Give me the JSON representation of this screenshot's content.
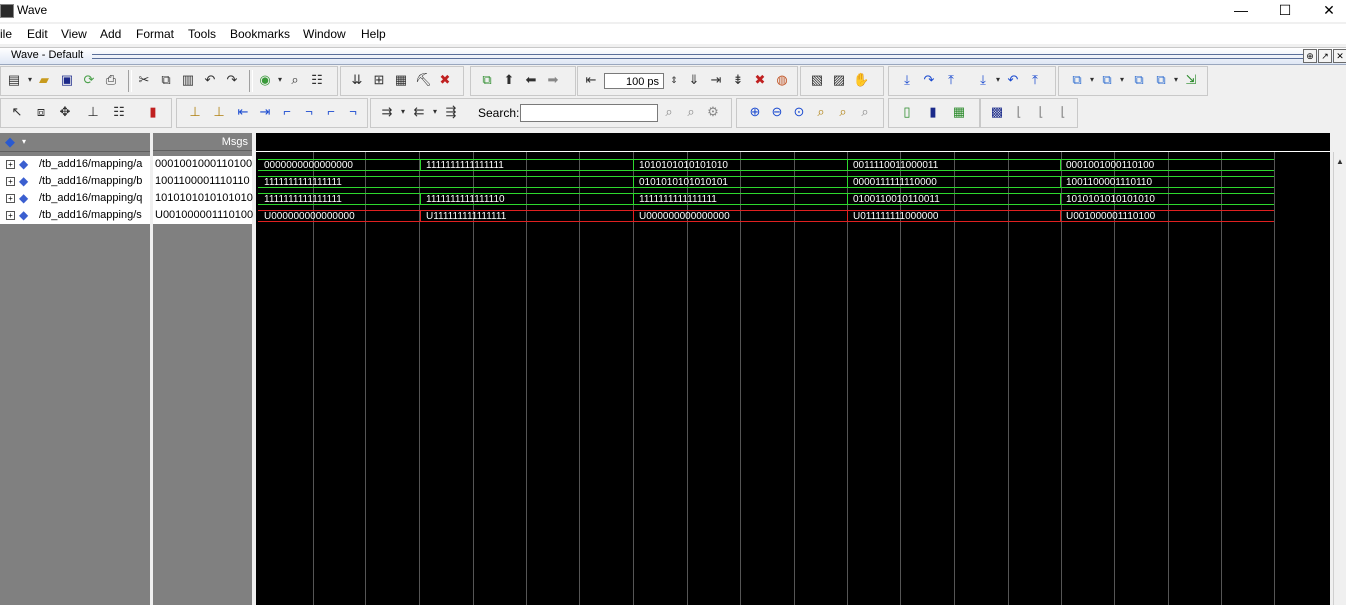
{
  "window": {
    "title": "Wave"
  },
  "window_controls": {
    "minimize": "—",
    "maximize": "☐",
    "close": "✕"
  },
  "menu": [
    "ile",
    "Edit",
    "View",
    "Add",
    "Format",
    "Tools",
    "Bookmarks",
    "Window",
    "Help"
  ],
  "wave_window": {
    "title": "Wave - Default"
  },
  "toolbar": {
    "time_value": "100 ps",
    "search_label": "Search:",
    "search_value": ""
  },
  "panes": {
    "msgs_header": "Msgs"
  },
  "signals": [
    {
      "name": "/tb_add16/mapping/a",
      "value": "0001001000110100",
      "color": "#2dd82d",
      "segments": [
        "0000000000000000",
        "1111111111111111",
        "1010101010101010",
        "0011110011000011",
        "0001001000110100"
      ]
    },
    {
      "name": "/tb_add16/mapping/b",
      "value": "1001100001110110",
      "color": "#2dd82d",
      "segments": [
        "1111111111111111",
        "0101010101010101",
        "0000111111110000",
        "1001100001110110"
      ]
    },
    {
      "name": "/tb_add16/mapping/q",
      "value": "1010101010101010",
      "color": "#2dd82d",
      "segments": [
        "1111111111111111",
        "1111111111111110",
        "1111111111111111",
        "0100110010110011",
        "1010101010101010"
      ]
    },
    {
      "name": "/tb_add16/mapping/s",
      "value": "U001000001110100",
      "color": "#e02020",
      "segments": [
        "U000000000000000",
        "U111111111111111",
        "U000000000000000",
        "U011111111000000",
        "U001000001110100"
      ]
    }
  ]
}
